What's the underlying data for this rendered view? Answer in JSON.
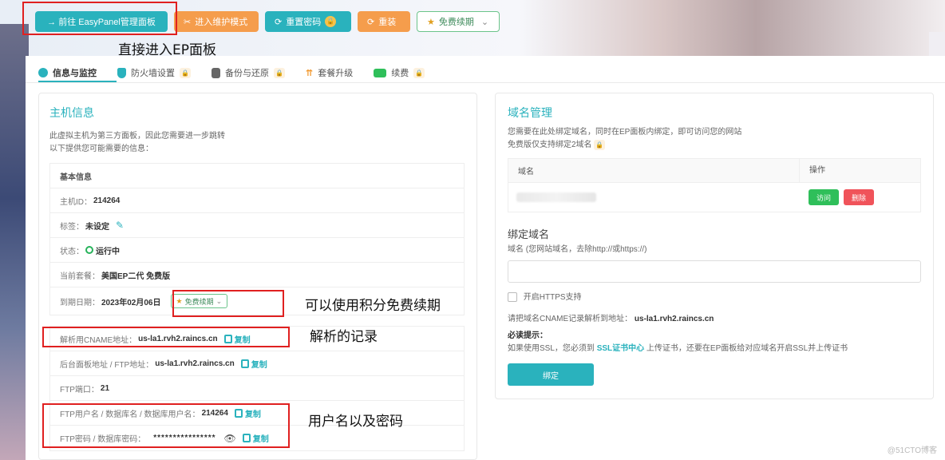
{
  "topbar": {
    "goto_ep": "→ 前往 EasyPanel管理面板",
    "maintenance": "进入维护模式",
    "reset_password": "重置密码",
    "reinstall": "重装",
    "free_renew": "免费续期"
  },
  "tabs": [
    {
      "label": "信息与监控"
    },
    {
      "label": "防火墙设置"
    },
    {
      "label": "备份与还原"
    },
    {
      "label": "套餐升级"
    },
    {
      "label": "续费"
    }
  ],
  "host_info": {
    "title": "主机信息",
    "desc_line1": "此虚拟主机为第三方面板，因此您需要进一步跳转",
    "desc_line2": "以下提供您可能需要的信息：",
    "basic_info": "基本信息",
    "host_id_label": "主机ID：",
    "host_id": "214264",
    "tag_label": "标签：",
    "tag_value": "未设定",
    "status_label": "状态：",
    "status_value": "运行中",
    "plan_label": "当前套餐：",
    "plan_value": "美国EP二代 免费版",
    "expire_label": "到期日期：",
    "expire_value": "2023年02月06日",
    "renew_label": "免费续期",
    "cname_label": "解析用CNAME地址：",
    "cname_value": "us-la1.rvh2.raincs.cn",
    "copy": "复制",
    "panel_addr_label": "后台面板地址 / FTP地址：",
    "panel_addr_value": "us-la1.rvh2.raincs.cn",
    "ftp_port_label": "FTP端口：",
    "ftp_port_value": "21",
    "ftp_user_label": "FTP用户名 / 数据库名 / 数据库用户名：",
    "ftp_user_value": "214264",
    "ftp_pass_label": "FTP密码 / 数据库密码：",
    "ftp_pass_value": "****************"
  },
  "domain": {
    "title": "域名管理",
    "desc1": "您需要在此处绑定域名，同时在EP面板内绑定，即可访问您的网站",
    "desc2": "免费版仅支持绑定2域名",
    "col_domain": "域名",
    "col_action": "操作",
    "visit": "访问",
    "delete": "删除",
    "bind_title": "绑定域名",
    "bind_field_label": "域名 (您网站域名，去除http://或https://)",
    "https_label": "开启HTTPS支持",
    "cname_hint_prefix": "请把域名CNAME记录解析到地址：",
    "cname_hint_value": "us-la1.rvh2.raincs.cn",
    "must_read": "必读提示：",
    "ssl_pre": "如果使用SSL，您必须到",
    "ssl_link": "SSL证书中心",
    "ssl_post": "上传证书，还要在EP面板给对应域名开启SSL并上传证书",
    "bind_button": "绑定"
  },
  "annotations": {
    "a1": "直接进入EP面板",
    "a2": "可以使用积分免费续期",
    "a3": "解析的记录",
    "a4": "用户名以及密码"
  },
  "watermark": "@51CTO博客",
  "colors": {
    "accent": "#2ab2bd",
    "orange": "#f59d4c",
    "green": "#2fbf5a",
    "red": "#f0535a",
    "annotation": "#e02020"
  }
}
